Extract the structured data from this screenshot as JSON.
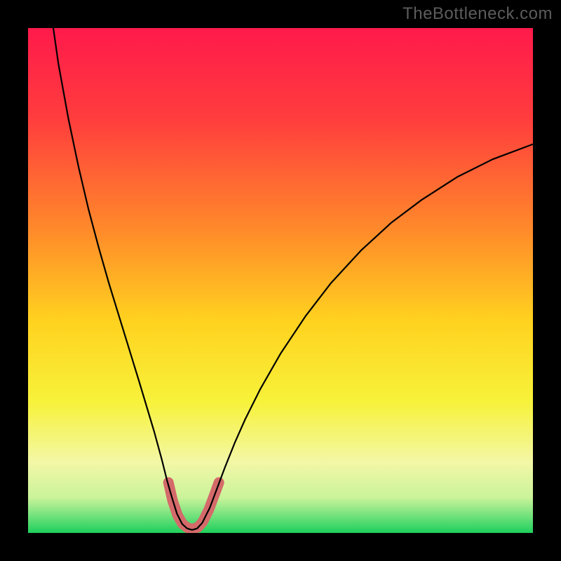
{
  "watermark": "TheBottleneck.com",
  "chart_data": {
    "type": "line",
    "title": "",
    "xlabel": "",
    "ylabel": "",
    "xlim": [
      0,
      100
    ],
    "ylim": [
      0,
      100
    ],
    "gradient_stops": [
      {
        "offset": 0.0,
        "color": "#ff1a4b"
      },
      {
        "offset": 0.18,
        "color": "#ff3d3d"
      },
      {
        "offset": 0.4,
        "color": "#ff8a2a"
      },
      {
        "offset": 0.58,
        "color": "#ffd21f"
      },
      {
        "offset": 0.74,
        "color": "#f7f23a"
      },
      {
        "offset": 0.86,
        "color": "#f3f7a6"
      },
      {
        "offset": 0.93,
        "color": "#caf39a"
      },
      {
        "offset": 0.965,
        "color": "#74e27d"
      },
      {
        "offset": 1.0,
        "color": "#1ecf5c"
      }
    ],
    "series": [
      {
        "name": "black-curve",
        "stroke": "#000000",
        "stroke_width": 2.2,
        "points": [
          {
            "x": 5.0,
            "y": 100.0
          },
          {
            "x": 6.0,
            "y": 93.0
          },
          {
            "x": 8.0,
            "y": 82.0
          },
          {
            "x": 10.0,
            "y": 72.5
          },
          {
            "x": 12.0,
            "y": 64.0
          },
          {
            "x": 14.0,
            "y": 56.5
          },
          {
            "x": 16.0,
            "y": 49.5
          },
          {
            "x": 18.0,
            "y": 43.0
          },
          {
            "x": 20.0,
            "y": 36.5
          },
          {
            "x": 22.0,
            "y": 30.0
          },
          {
            "x": 23.5,
            "y": 25.0
          },
          {
            "x": 25.0,
            "y": 20.0
          },
          {
            "x": 26.5,
            "y": 14.5
          },
          {
            "x": 27.5,
            "y": 10.5
          },
          {
            "x": 28.5,
            "y": 7.0
          },
          {
            "x": 29.5,
            "y": 3.8
          },
          {
            "x": 30.5,
            "y": 1.8
          },
          {
            "x": 31.5,
            "y": 0.9
          },
          {
            "x": 32.5,
            "y": 0.6
          },
          {
            "x": 33.5,
            "y": 0.9
          },
          {
            "x": 34.5,
            "y": 2.0
          },
          {
            "x": 36.0,
            "y": 5.0
          },
          {
            "x": 37.5,
            "y": 9.0
          },
          {
            "x": 39.0,
            "y": 13.0
          },
          {
            "x": 41.0,
            "y": 18.0
          },
          {
            "x": 43.0,
            "y": 22.5
          },
          {
            "x": 46.0,
            "y": 28.5
          },
          {
            "x": 50.0,
            "y": 35.5
          },
          {
            "x": 55.0,
            "y": 43.0
          },
          {
            "x": 60.0,
            "y": 49.5
          },
          {
            "x": 66.0,
            "y": 56.0
          },
          {
            "x": 72.0,
            "y": 61.5
          },
          {
            "x": 78.0,
            "y": 66.0
          },
          {
            "x": 85.0,
            "y": 70.5
          },
          {
            "x": 92.0,
            "y": 74.0
          },
          {
            "x": 100.0,
            "y": 77.0
          }
        ]
      },
      {
        "name": "pink-highlight",
        "stroke": "#d46a6a",
        "stroke_width": 15,
        "linecap": "round",
        "points": [
          {
            "x": 27.8,
            "y": 10.0
          },
          {
            "x": 28.6,
            "y": 6.5
          },
          {
            "x": 29.6,
            "y": 3.5
          },
          {
            "x": 30.6,
            "y": 1.8
          },
          {
            "x": 31.6,
            "y": 1.0
          },
          {
            "x": 32.6,
            "y": 0.8
          },
          {
            "x": 33.6,
            "y": 1.1
          },
          {
            "x": 34.6,
            "y": 2.2
          },
          {
            "x": 35.8,
            "y": 4.6
          },
          {
            "x": 37.0,
            "y": 7.8
          },
          {
            "x": 37.8,
            "y": 10.0
          }
        ]
      }
    ]
  }
}
